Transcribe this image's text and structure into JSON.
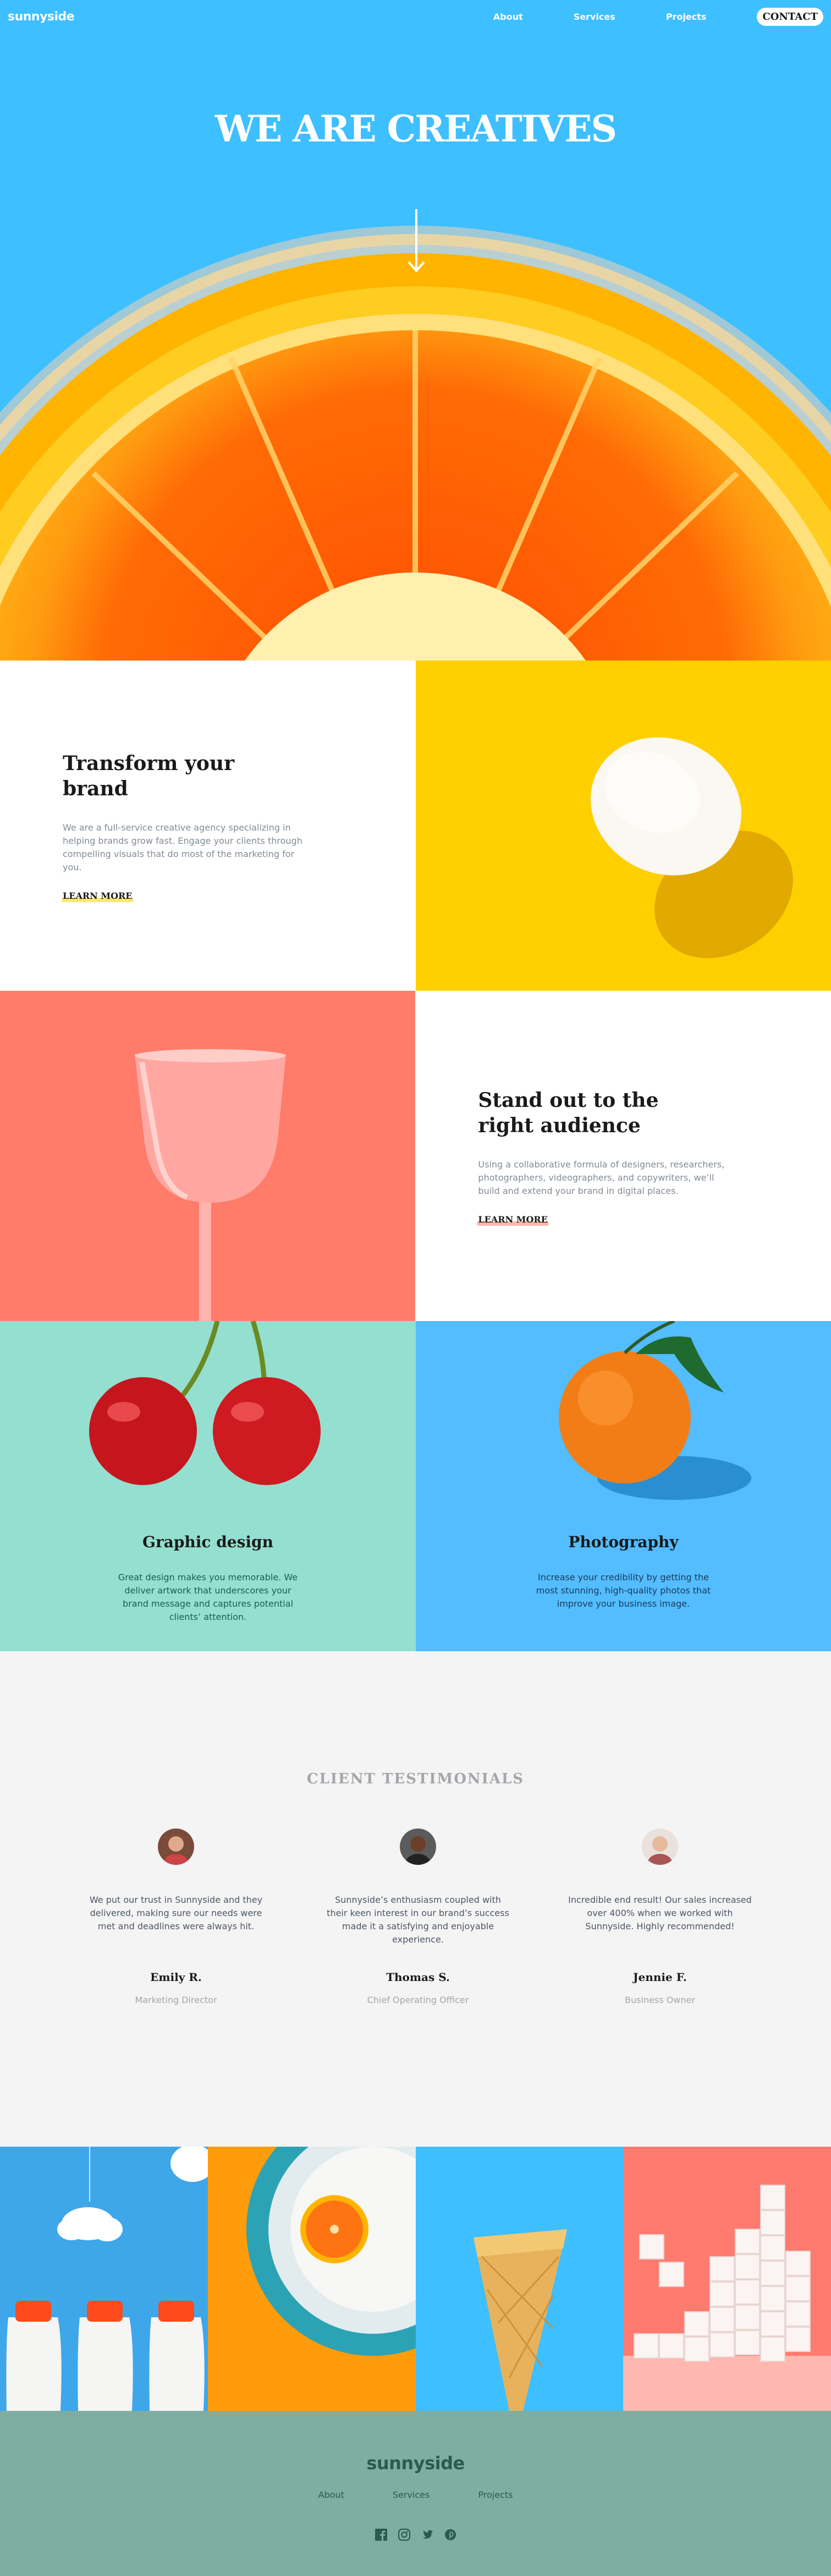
{
  "nav": {
    "logo": "sunnyside",
    "links": [
      "About",
      "Services",
      "Projects"
    ],
    "contact": "CONTACT"
  },
  "hero": {
    "title": "WE ARE CREATIVES",
    "arrow_icon": "arrow-down-icon"
  },
  "features": [
    {
      "title": "Transform your brand",
      "body": "We are a full-service creative agency specializing in helping brands grow fast. Engage your clients through compelling visuals that do most of the marketing for you.",
      "link": "LEARN MORE",
      "accent": "#fad400"
    },
    {
      "title": "Stand out to the right audience",
      "body": "Using a collaborative formula of designers, researchers, photographers, videographers, and copywriters, we’ll build and extend your brand in digital places.",
      "link": "LEARN MORE",
      "accent": "#ff7b6a"
    }
  ],
  "services": [
    {
      "title": "Graphic design",
      "body": "Great design makes you memorable. We deliver artwork that underscores your brand message and captures potential clients’ attention.",
      "color": "#1a5e53",
      "bg": "#94dfcf"
    },
    {
      "title": "Photography",
      "body": "Increase your credibility by getting the most stunning, high-quality photos that improve your business image.",
      "color": "#173a5a",
      "bg": "#53bdff"
    }
  ],
  "testimonials": {
    "title": "CLIENT TESTIMONIALS",
    "items": [
      {
        "quote": "We put our trust in Sunnyside and they delivered, making sure our needs were met and deadlines were always hit.",
        "name": "Emily R.",
        "role": "Marketing Director"
      },
      {
        "quote": "Sunnyside’s enthusiasm coupled with their keen interest in our brand’s success made it a satisfying and enjoyable experience.",
        "name": "Thomas S.",
        "role": "Chief Operating Officer"
      },
      {
        "quote": "Incredible end result! Our sales increased over 400% when we worked with Sunnyside. Highly recommended!",
        "name": "Jennie F.",
        "role": "Business Owner"
      }
    ]
  },
  "gallery": [
    "milk-bottles-image",
    "orange-plate-image",
    "ice-cream-cone-image",
    "sugar-cubes-image"
  ],
  "footer": {
    "logo": "sunnyside",
    "links": [
      "About",
      "Services",
      "Projects"
    ],
    "social_icons": [
      "facebook-icon",
      "instagram-icon",
      "twitter-icon",
      "pinterest-icon"
    ]
  }
}
